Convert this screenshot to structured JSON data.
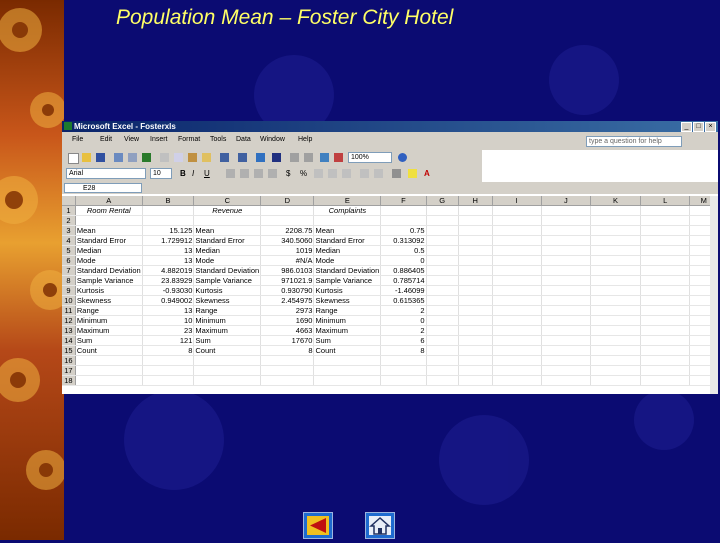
{
  "slide": {
    "title": "Population Mean – Foster City Hotel"
  },
  "excel": {
    "window_title": "Microsoft Excel - Fosterxls",
    "menu": [
      "File",
      "Edit",
      "View",
      "Insert",
      "Format",
      "Tools",
      "Data",
      "Window",
      "Help"
    ],
    "help_placeholder": "type a question for help",
    "font_name": "Arial",
    "font_size": "10",
    "zoom": "100%",
    "name_box": "E28",
    "columns": [
      "A",
      "B",
      "C",
      "D",
      "E",
      "F",
      "G",
      "H",
      "I",
      "J",
      "K",
      "L",
      "M"
    ],
    "rows": [
      {
        "n": "1",
        "cells": [
          "Room Rental",
          "",
          "Revenue",
          "",
          "Complaints",
          "",
          "",
          "",
          "",
          "",
          "",
          "",
          ""
        ]
      },
      {
        "n": "2",
        "cells": [
          "",
          "",
          "",
          "",
          "",
          "",
          "",
          "",
          "",
          "",
          "",
          "",
          ""
        ]
      },
      {
        "n": "3",
        "cells": [
          "Mean",
          "15.125",
          "Mean",
          "2208.75",
          "Mean",
          "0.75",
          "",
          "",
          "",
          "",
          "",
          "",
          ""
        ]
      },
      {
        "n": "4",
        "cells": [
          "Standard Error",
          "1.729912",
          "Standard Error",
          "340.5060",
          "Standard Error",
          "0.313092",
          "",
          "",
          "",
          "",
          "",
          "",
          ""
        ]
      },
      {
        "n": "5",
        "cells": [
          "Median",
          "13",
          "Median",
          "1019",
          "Median",
          "0.5",
          "",
          "",
          "",
          "",
          "",
          "",
          ""
        ]
      },
      {
        "n": "6",
        "cells": [
          "Mode",
          "13",
          "Mode",
          "#N/A",
          "Mode",
          "0",
          "",
          "",
          "",
          "",
          "",
          "",
          ""
        ]
      },
      {
        "n": "7",
        "cells": [
          "Standard Deviation",
          "4.882019",
          "Standard Deviation",
          "986.0103",
          "Standard Deviation",
          "0.886405",
          "",
          "",
          "",
          "",
          "",
          "",
          ""
        ]
      },
      {
        "n": "8",
        "cells": [
          "Sample Variance",
          "23.83929",
          "Sample Variance",
          "971021.9",
          "Sample Variance",
          "0.785714",
          "",
          "",
          "",
          "",
          "",
          "",
          ""
        ]
      },
      {
        "n": "9",
        "cells": [
          "Kurtosis",
          "-0.93030",
          "Kurtosis",
          "0.930790",
          "Kurtosis",
          "-1.46099",
          "",
          "",
          "",
          "",
          "",
          "",
          ""
        ]
      },
      {
        "n": "10",
        "cells": [
          "Skewness",
          "0.949002",
          "Skewness",
          "2.454975",
          "Skewness",
          "0.615365",
          "",
          "",
          "",
          "",
          "",
          "",
          ""
        ]
      },
      {
        "n": "11",
        "cells": [
          "Range",
          "13",
          "Range",
          "2973",
          "Range",
          "2",
          "",
          "",
          "",
          "",
          "",
          "",
          ""
        ]
      },
      {
        "n": "12",
        "cells": [
          "Minimum",
          "10",
          "Minimum",
          "1690",
          "Minimum",
          "0",
          "",
          "",
          "",
          "",
          "",
          "",
          ""
        ]
      },
      {
        "n": "13",
        "cells": [
          "Maximum",
          "23",
          "Maximum",
          "4663",
          "Maximum",
          "2",
          "",
          "",
          "",
          "",
          "",
          "",
          ""
        ]
      },
      {
        "n": "14",
        "cells": [
          "Sum",
          "121",
          "Sum",
          "17670",
          "Sum",
          "6",
          "",
          "",
          "",
          "",
          "",
          "",
          ""
        ]
      },
      {
        "n": "15",
        "cells": [
          "Count",
          "8",
          "Count",
          "8",
          "Count",
          "8",
          "",
          "",
          "",
          "",
          "",
          "",
          ""
        ]
      },
      {
        "n": "16",
        "cells": [
          "",
          "",
          "",
          "",
          "",
          "",
          "",
          "",
          "",
          "",
          "",
          "",
          ""
        ]
      },
      {
        "n": "17",
        "cells": [
          "",
          "",
          "",
          "",
          "",
          "",
          "",
          "",
          "",
          "",
          "",
          "",
          ""
        ]
      },
      {
        "n": "18",
        "cells": [
          "",
          "",
          "",
          "",
          "",
          "",
          "",
          "",
          "",
          "",
          "",
          "",
          ""
        ]
      }
    ]
  },
  "nav": {
    "back_icon": "back-arrow-icon",
    "home_icon": "home-icon"
  }
}
